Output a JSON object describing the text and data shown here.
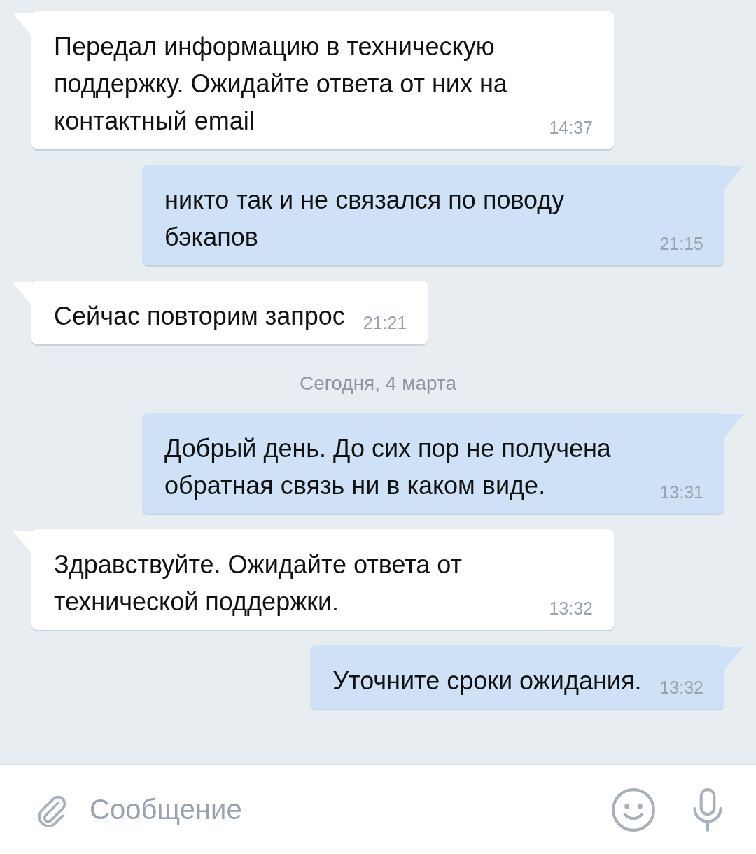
{
  "messages": [
    {
      "kind": "incoming",
      "text": "Передал информацию в техническую поддержку. Ожидайте ответа от них на контактный email",
      "time": "14:37"
    },
    {
      "kind": "outgoing",
      "text": "никто так и не связался по поводу бэкапов",
      "time": "21:15"
    },
    {
      "kind": "incoming",
      "text": "Сейчас повторим запрос",
      "time": "21:21"
    },
    {
      "kind": "date",
      "text": "Сегодня, 4 марта"
    },
    {
      "kind": "outgoing",
      "text": "Добрый день. До сих пор не получена обратная связь ни в каком виде.",
      "time": "13:31"
    },
    {
      "kind": "incoming",
      "text": "Здравствуйте. Ожидайте ответа от технической поддержки.",
      "time": "13:32"
    },
    {
      "kind": "outgoing",
      "text": "Уточните сроки ожидания.",
      "time": "13:32"
    }
  ],
  "composer": {
    "placeholder": "Сообщение"
  }
}
